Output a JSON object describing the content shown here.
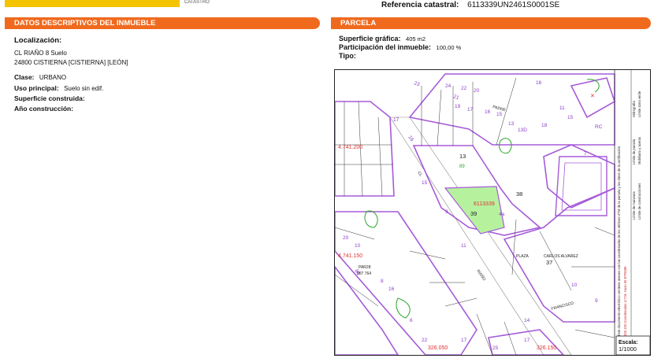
{
  "header": {
    "logo_small_text": "CATASTRO",
    "reference_label": "Referencia catastral:",
    "reference_value": "6113339UN2461S0001SE"
  },
  "left_section": {
    "title": "DATOS DESCRIPTIVOS DEL INMUEBLE",
    "location_label": "Localización:",
    "address_line1": "CL RIAÑO 8 Suelo",
    "address_line2": "24800 CISTIERNA [CISTIERNA] [LEÓN]",
    "clase_label": "Clase:",
    "clase_value": "URBANO",
    "uso_label": "Uso principal:",
    "uso_value": "Suelo sin edif.",
    "superficie_label": "Superficie construida:",
    "anio_label": "Año construcción:"
  },
  "right_section": {
    "title": "PARCELA",
    "superficie_grafica_label": "Superficie gráfica:",
    "superficie_grafica_value": "405 m2",
    "participacion_label": "Participación del inmueble:",
    "participacion_value": "100,00 %",
    "tipo_label": "Tipo:"
  },
  "map": {
    "parcel_ref": "6113339",
    "parcel_number": "39",
    "block_13": "13",
    "block_13_sub": "89",
    "block_38": "38",
    "block_37": "37",
    "plaza_label": "PLAZA",
    "plaza_name": "CARLOS ALVAREZ",
    "street_riano": "RIAÑO",
    "street_francisco": "FRANCISCO",
    "street_padre": "PADRE",
    "street_cl": "CL",
    "coord_y1": "4.741.200",
    "coord_y2": "4.741.150",
    "coord_x1": "326.050",
    "coord_x2": "326.150",
    "paraje_label": "PAR28",
    "paraje_value": "007 764",
    "scale_label": "Escala:",
    "scale_value": "1/1000",
    "legend_1": "Límite de manzana",
    "legend_2": "Límite de parcela",
    "legend_3": "Hidrografía",
    "legend_4": "Límite de construcciones",
    "legend_5": "Mobiliario y aceras",
    "legend_6": "Límite zona verde",
    "coord_note": "326.150 Coordenadas U.T.M. Huso 30 ETRS89",
    "doc_note": "Este documento electrónico contiene anexos con las coordenadas de los vértices UTM de la parcela y los datos de la certificación."
  }
}
